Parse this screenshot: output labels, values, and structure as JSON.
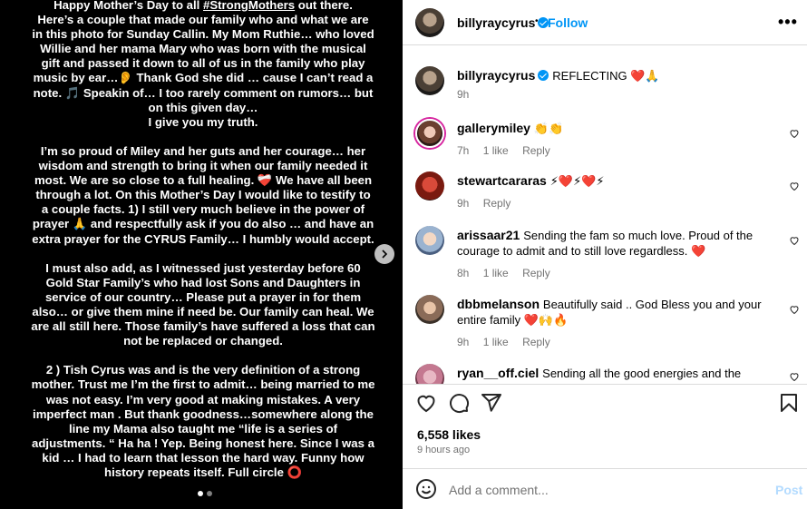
{
  "media": {
    "story_text": "Happy Mother’s Day to all #StrongMothers out there.\nHere’s a couple that made our family who and what we are in this photo for Sunday Callin.  My Mom Ruthie… who loved Willie and her mama Mary who was born with the musical gift and passed it down to all of us in the family who play music by ear…👂 Thank God she did … cause I can’t read a note. 🎵 Speakin of… I too rarely comment on rumors… but on this given day…\nI give you my truth.\n\nI’m so proud of Miley and her guts and her courage… her wisdom and strength to bring it when our family needed it most. We are so close to a full healing. ❤️‍🩹 We have all been through a lot. On this Mother’s Day I would like to testify to a couple facts. 1)  I still very much believe in the power of prayer 🙏 and respectfully ask if you do also … and have an extra prayer for the CYRUS Family… I humbly would accept.\n\nI must also add, as I witnessed just yesterday before 60 Gold Star Family’s who had lost Sons and Daughters in service of our country… Please put a prayer in for them also… or give them mine if need be. Our family can heal. We are all still here.  Those family’s have suffered a loss that can not be replaced or changed.\n\n2 ) Tish Cyrus was and is the very definition of a strong mother. Trust me  I’m the first to admit…  being married to me was not easy. I’m very good at making mistakes.  A very imperfect man .  But thank goodness…somewhere along the line my Mama also taught me “life is a series of adjustments. “ Ha ha ! Yep. Being honest here.  Since I was a kid … I had to learn that lesson the hard way.  Funny how history repeats itself. Full circle ⭕"
  },
  "header": {
    "username": "billyraycyrus",
    "separator": "•",
    "follow_label": "Follow",
    "more_label": "•••"
  },
  "caption": {
    "username": "billyraycyrus",
    "text": "REFLECTING ❤️🙏",
    "time": "9h"
  },
  "comments": [
    {
      "username": "gallerymiley",
      "text": "👏👏",
      "time": "7h",
      "likes": "1 like",
      "reply": "Reply"
    },
    {
      "username": "stewartcararas",
      "text": "⚡❤️⚡❤️⚡",
      "time": "9h",
      "likes": "",
      "reply": "Reply"
    },
    {
      "username": "arissaar21",
      "text": "Sending the fam so much love. Proud of the courage to admit and to still love regardless. ❤️",
      "time": "8h",
      "likes": "1 like",
      "reply": "Reply"
    },
    {
      "username": "dbbmelanson",
      "text": "Beautifully said .. God Bless you and your entire family ❤️🙌🔥",
      "time": "9h",
      "likes": "1 like",
      "reply": "Reply"
    },
    {
      "username": "ryan__off.ciel",
      "text": "Sending all the good energies and the positive",
      "time": "",
      "likes": "",
      "reply": ""
    }
  ],
  "actions": {
    "likes": "6,558 likes",
    "time": "9 hours ago"
  },
  "add_comment": {
    "placeholder": "Add a comment...",
    "post_label": "Post"
  },
  "colors": {
    "accent": "#0095f6",
    "muted": "#737373",
    "border": "#dbdbdb",
    "post_disabled": "#b3dbff"
  },
  "icons": [
    "chevron-right-icon",
    "verified-icon",
    "more-icon",
    "heart-icon",
    "comment-icon",
    "share-icon",
    "bookmark-icon",
    "emoji-icon"
  ]
}
